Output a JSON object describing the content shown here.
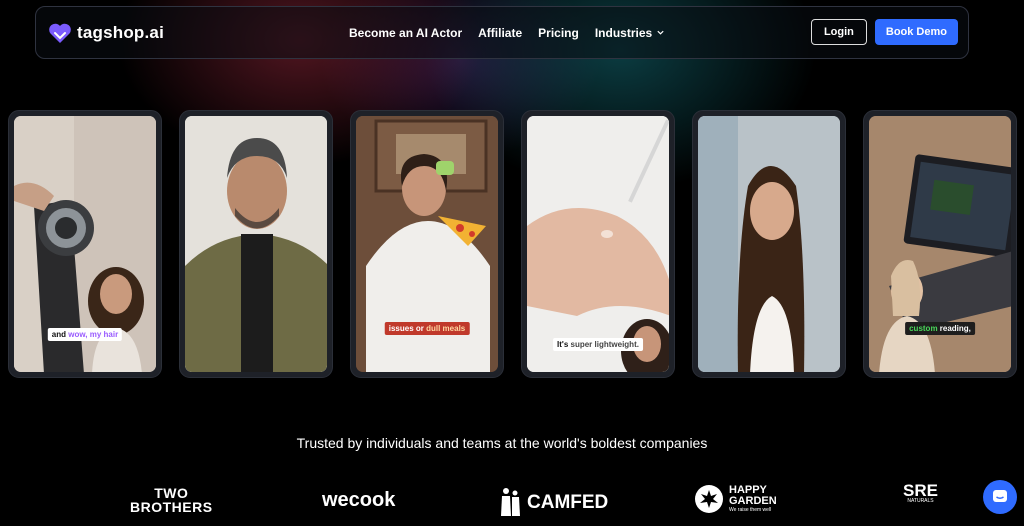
{
  "brand": {
    "name": "tagshop.ai",
    "accent": "#2f6bff",
    "logo_color": "#7b5cff"
  },
  "nav": {
    "links": [
      "Become an AI Actor",
      "Affiliate",
      "Pricing",
      "Industries"
    ],
    "login_label": "Login",
    "demo_label": "Book Demo"
  },
  "cards": [
    {
      "caption": [
        "and",
        " wow, my hair"
      ]
    },
    {
      "caption": []
    },
    {
      "caption": [
        "issues or",
        " dull meals"
      ]
    },
    {
      "caption": [
        "It's",
        " super lightweight."
      ]
    },
    {
      "caption": []
    },
    {
      "caption": [
        "custom",
        " reading,"
      ]
    }
  ],
  "trusted_text": "Trusted by individuals and teams at the world's boldest companies",
  "brands": {
    "two_brothers": [
      "TWO",
      "BROTHERS"
    ],
    "wecook": "wecook",
    "camfed": "CAMFED",
    "happy_garden": [
      "HAPPY",
      "GARDEN",
      "We raise them well"
    ],
    "sre": [
      "SRE",
      "NATURALS"
    ]
  }
}
